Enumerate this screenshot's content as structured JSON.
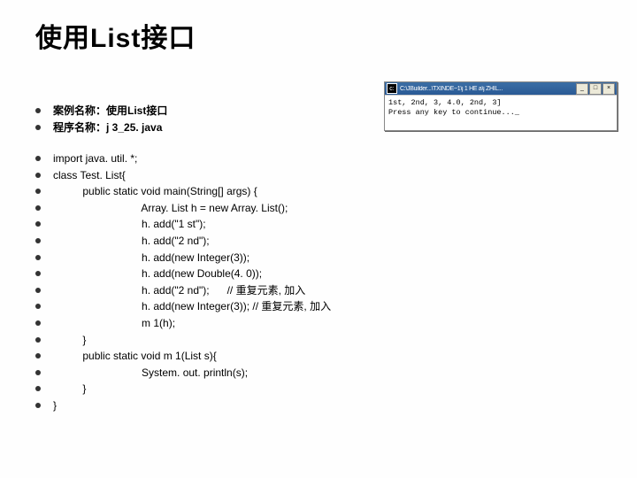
{
  "title": "使用List接口",
  "console": {
    "titlebar": "C:\\JBuilder...\\TXINDE~1\\j 1 HE a\\j ZHIL...",
    "lines": [
      "1st, 2nd, 3, 4.0, 2nd, 3]",
      "Press any key to continue..._"
    ]
  },
  "meta": [
    "案例名称：使用List接口",
    "程序名称：j 3_25. java"
  ],
  "code": [
    "import java. util. *;",
    "class Test. List{",
    "          public static void main(String[] args) {",
    "                              Array. List h = new Array. List();",
    "                              h. add(\"1 st\");",
    "                              h. add(\"2 nd\");",
    "                              h. add(new Integer(3));",
    "                              h. add(new Double(4. 0));",
    "                              h. add(\"2 nd\");      // 重复元素, 加入",
    "                              h. add(new Integer(3)); // 重复元素, 加入",
    "                              m 1(h);",
    "          }",
    "          public static void m 1(List s){",
    "                              System. out. println(s);",
    "          }",
    "}"
  ]
}
